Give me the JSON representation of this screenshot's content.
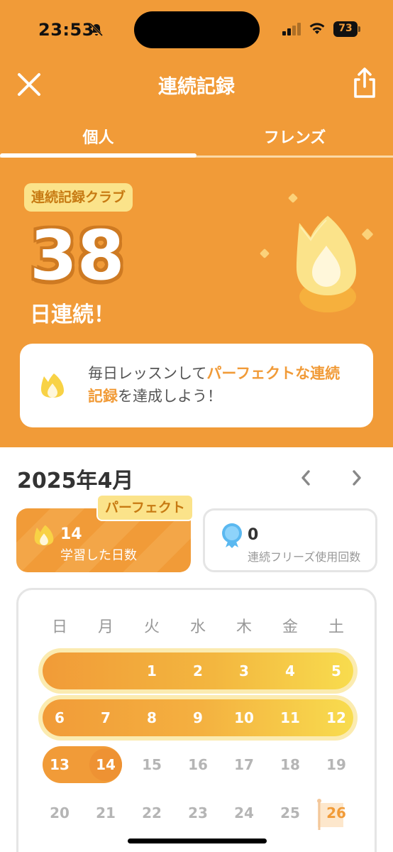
{
  "status_bar": {
    "time": "23:53",
    "battery": "73"
  },
  "header": {
    "title": "連続記録"
  },
  "tabs": [
    {
      "label": "個人"
    },
    {
      "label": "フレンズ"
    }
  ],
  "streak": {
    "club_badge": "連続記録クラブ",
    "days": "38",
    "label": "日連続！"
  },
  "tip": {
    "text_1": "毎日レッスンして",
    "highlight_1": "パーフェクトな連続記録",
    "text_2": "を達成しよう！"
  },
  "calendar": {
    "month": "2025年4月",
    "weekdays": [
      "日",
      "月",
      "火",
      "水",
      "木",
      "金",
      "土"
    ],
    "weeks": [
      [
        "",
        "",
        "1",
        "2",
        "3",
        "4",
        "5"
      ],
      [
        "6",
        "7",
        "8",
        "9",
        "10",
        "11",
        "12"
      ],
      [
        "13",
        "14",
        "15",
        "16",
        "17",
        "18",
        "19"
      ],
      [
        "20",
        "21",
        "22",
        "23",
        "24",
        "25",
        "26"
      ]
    ],
    "today": "26"
  },
  "stats": {
    "perfect_badge": "パーフェクト",
    "learned_days": "14",
    "learned_label": "学習した日数",
    "freeze_count": "0",
    "freeze_label": "連続フリーズ使用回数"
  },
  "colors": {
    "accent": "#F19B38",
    "badge": "#FBE38A",
    "freeze_blue": "#5AB8F0"
  },
  "icons": [
    "close-icon",
    "share-icon",
    "flame-icon",
    "freeze-icon",
    "chevron-left-icon",
    "chevron-right-icon",
    "flag-icon",
    "bell-off-icon",
    "signal-icon",
    "wifi-icon",
    "battery-icon"
  ]
}
